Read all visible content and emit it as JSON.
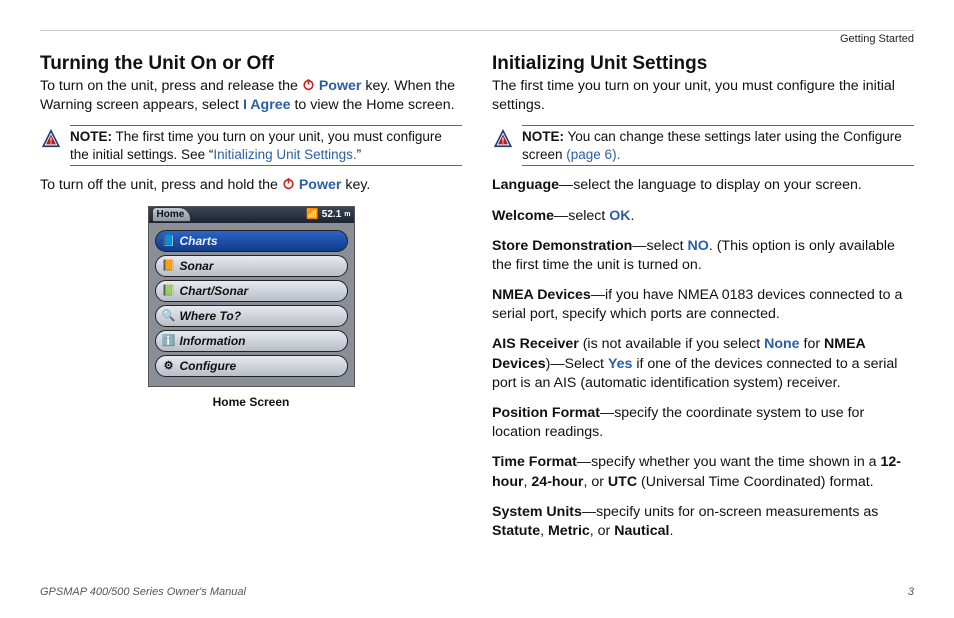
{
  "header": {
    "topic": "Getting Started"
  },
  "left": {
    "heading": "Turning the Unit On or Off",
    "intro_a": "To turn on the unit, press and release the ",
    "power_label": "Power",
    "intro_b": " key. When the Warning screen appears, select ",
    "i_agree": "I Agree",
    "intro_c": " to view the Home screen.",
    "note_label": "NOTE:",
    "note_a": " The first time you turn on your unit, you must configure the initial settings. See “",
    "note_link": "Initializing Unit Settings.",
    "note_b": "”",
    "off_a": "To turn off the unit, press and hold the ",
    "off_b": " key.",
    "caption": "Home Screen"
  },
  "screenshot": {
    "home_tab": "Home",
    "measurement": "52.1",
    "measurement_unit": "m",
    "items": [
      {
        "label": "Charts",
        "selected": true,
        "icon": "📘"
      },
      {
        "label": "Sonar",
        "selected": false,
        "icon": "📙"
      },
      {
        "label": "Chart/Sonar",
        "selected": false,
        "icon": "📗"
      },
      {
        "label": "Where To?",
        "selected": false,
        "icon": "🔍"
      },
      {
        "label": "Information",
        "selected": false,
        "icon": "ℹ️"
      },
      {
        "label": "Configure",
        "selected": false,
        "icon": "⚙"
      }
    ]
  },
  "right": {
    "heading": "Initializing Unit Settings",
    "intro": "The first time you turn on your unit, you must configure the initial settings.",
    "note_label": "NOTE:",
    "note_a": " You can change these settings later using the Configure screen ",
    "note_link": "(page 6).",
    "settings": {
      "language": {
        "name": "Language",
        "desc": "—select the language to display on your screen."
      },
      "welcome": {
        "name": "Welcome",
        "desc_a": "—select ",
        "link": "OK",
        "desc_b": "."
      },
      "store": {
        "name": "Store Demonstration",
        "desc_a": "—select ",
        "link": "NO",
        "desc_b": ". (This option is only available the first time the unit is turned on."
      },
      "nmea": {
        "name": "NMEA Devices",
        "desc": "—if you have NMEA 0183 devices connected to a serial port, specify which ports are connected."
      },
      "ais": {
        "name": "AIS Receiver",
        "desc_a": " (is not available if you select ",
        "link1": "None",
        "desc_b": " for ",
        "bold2": "NMEA Devices",
        "desc_c": ")—Select ",
        "link2": "Yes",
        "desc_d": " if one of the devices connected to a serial port is an AIS (automatic identification system) receiver."
      },
      "pos": {
        "name": "Position Format",
        "desc": "—specify the coordinate system to use for location readings."
      },
      "time": {
        "name": "Time Format",
        "desc_a": "—specify whether you want the time shown in a ",
        "b1": "12-hour",
        "s1": ", ",
        "b2": "24-hour",
        "s2": ", or ",
        "b3": "UTC",
        "desc_b": " (Universal Time Coordinated) format."
      },
      "units": {
        "name": "System Units",
        "desc_a": "—specify units for on-screen measurements as ",
        "b1": "Statute",
        "s1": ", ",
        "b2": "Metric",
        "s2": ", or ",
        "b3": "Nautical",
        "desc_b": "."
      }
    }
  },
  "footer": {
    "manual": "GPSMAP 400/500 Series Owner's Manual",
    "page": "3"
  }
}
